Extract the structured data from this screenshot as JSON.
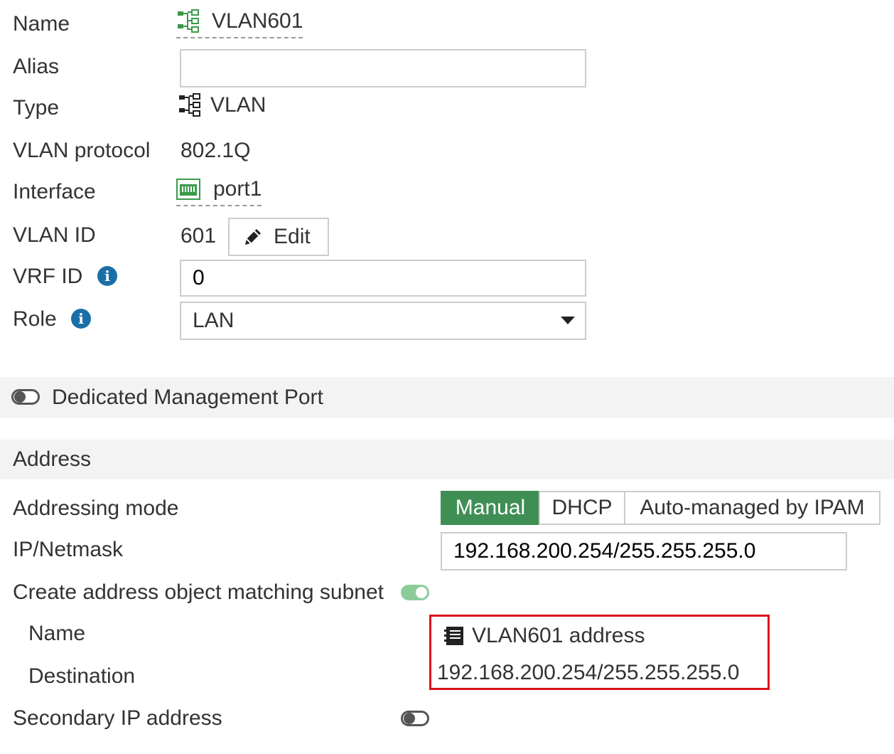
{
  "fields": {
    "name_label": "Name",
    "name_value": "VLAN601",
    "alias_label": "Alias",
    "alias_value": "",
    "type_label": "Type",
    "type_value": "VLAN",
    "vlan_protocol_label": "VLAN protocol",
    "vlan_protocol_value": "802.1Q",
    "interface_label": "Interface",
    "interface_value": "port1",
    "vlan_id_label": "VLAN ID",
    "vlan_id_value": "601",
    "edit_label": "Edit",
    "vrf_id_label": "VRF ID",
    "vrf_id_value": "0",
    "role_label": "Role",
    "role_value": "LAN"
  },
  "management": {
    "label": "Dedicated Management Port",
    "enabled": false
  },
  "address": {
    "section_title": "Address",
    "addressing_mode_label": "Addressing mode",
    "modes": [
      "Manual",
      "DHCP",
      "Auto-managed by IPAM"
    ],
    "selected_mode": "Manual",
    "ip_label": "IP/Netmask",
    "ip_value": "192.168.200.254/255.255.255.0",
    "create_object_label": "Create address object matching subnet",
    "create_object_enabled": true,
    "object_name_label": "Name",
    "object_name_value": "VLAN601 address",
    "destination_label": "Destination",
    "destination_value": "192.168.200.254/255.255.255.0",
    "secondary_ip_label": "Secondary IP address",
    "secondary_ip_enabled": false
  },
  "colors": {
    "accent_green": "#3f8f55",
    "toggle_on": "#8ccc9a",
    "info_blue": "#1b6fa8",
    "highlight_red": "#d9141b"
  },
  "icons": {
    "name": "vlan-icon",
    "type": "vlan-icon",
    "interface": "port-icon",
    "edit": "pencil-icon",
    "info": "info-icon",
    "dropdown": "caret-down-icon",
    "address_object": "address-book-icon"
  }
}
